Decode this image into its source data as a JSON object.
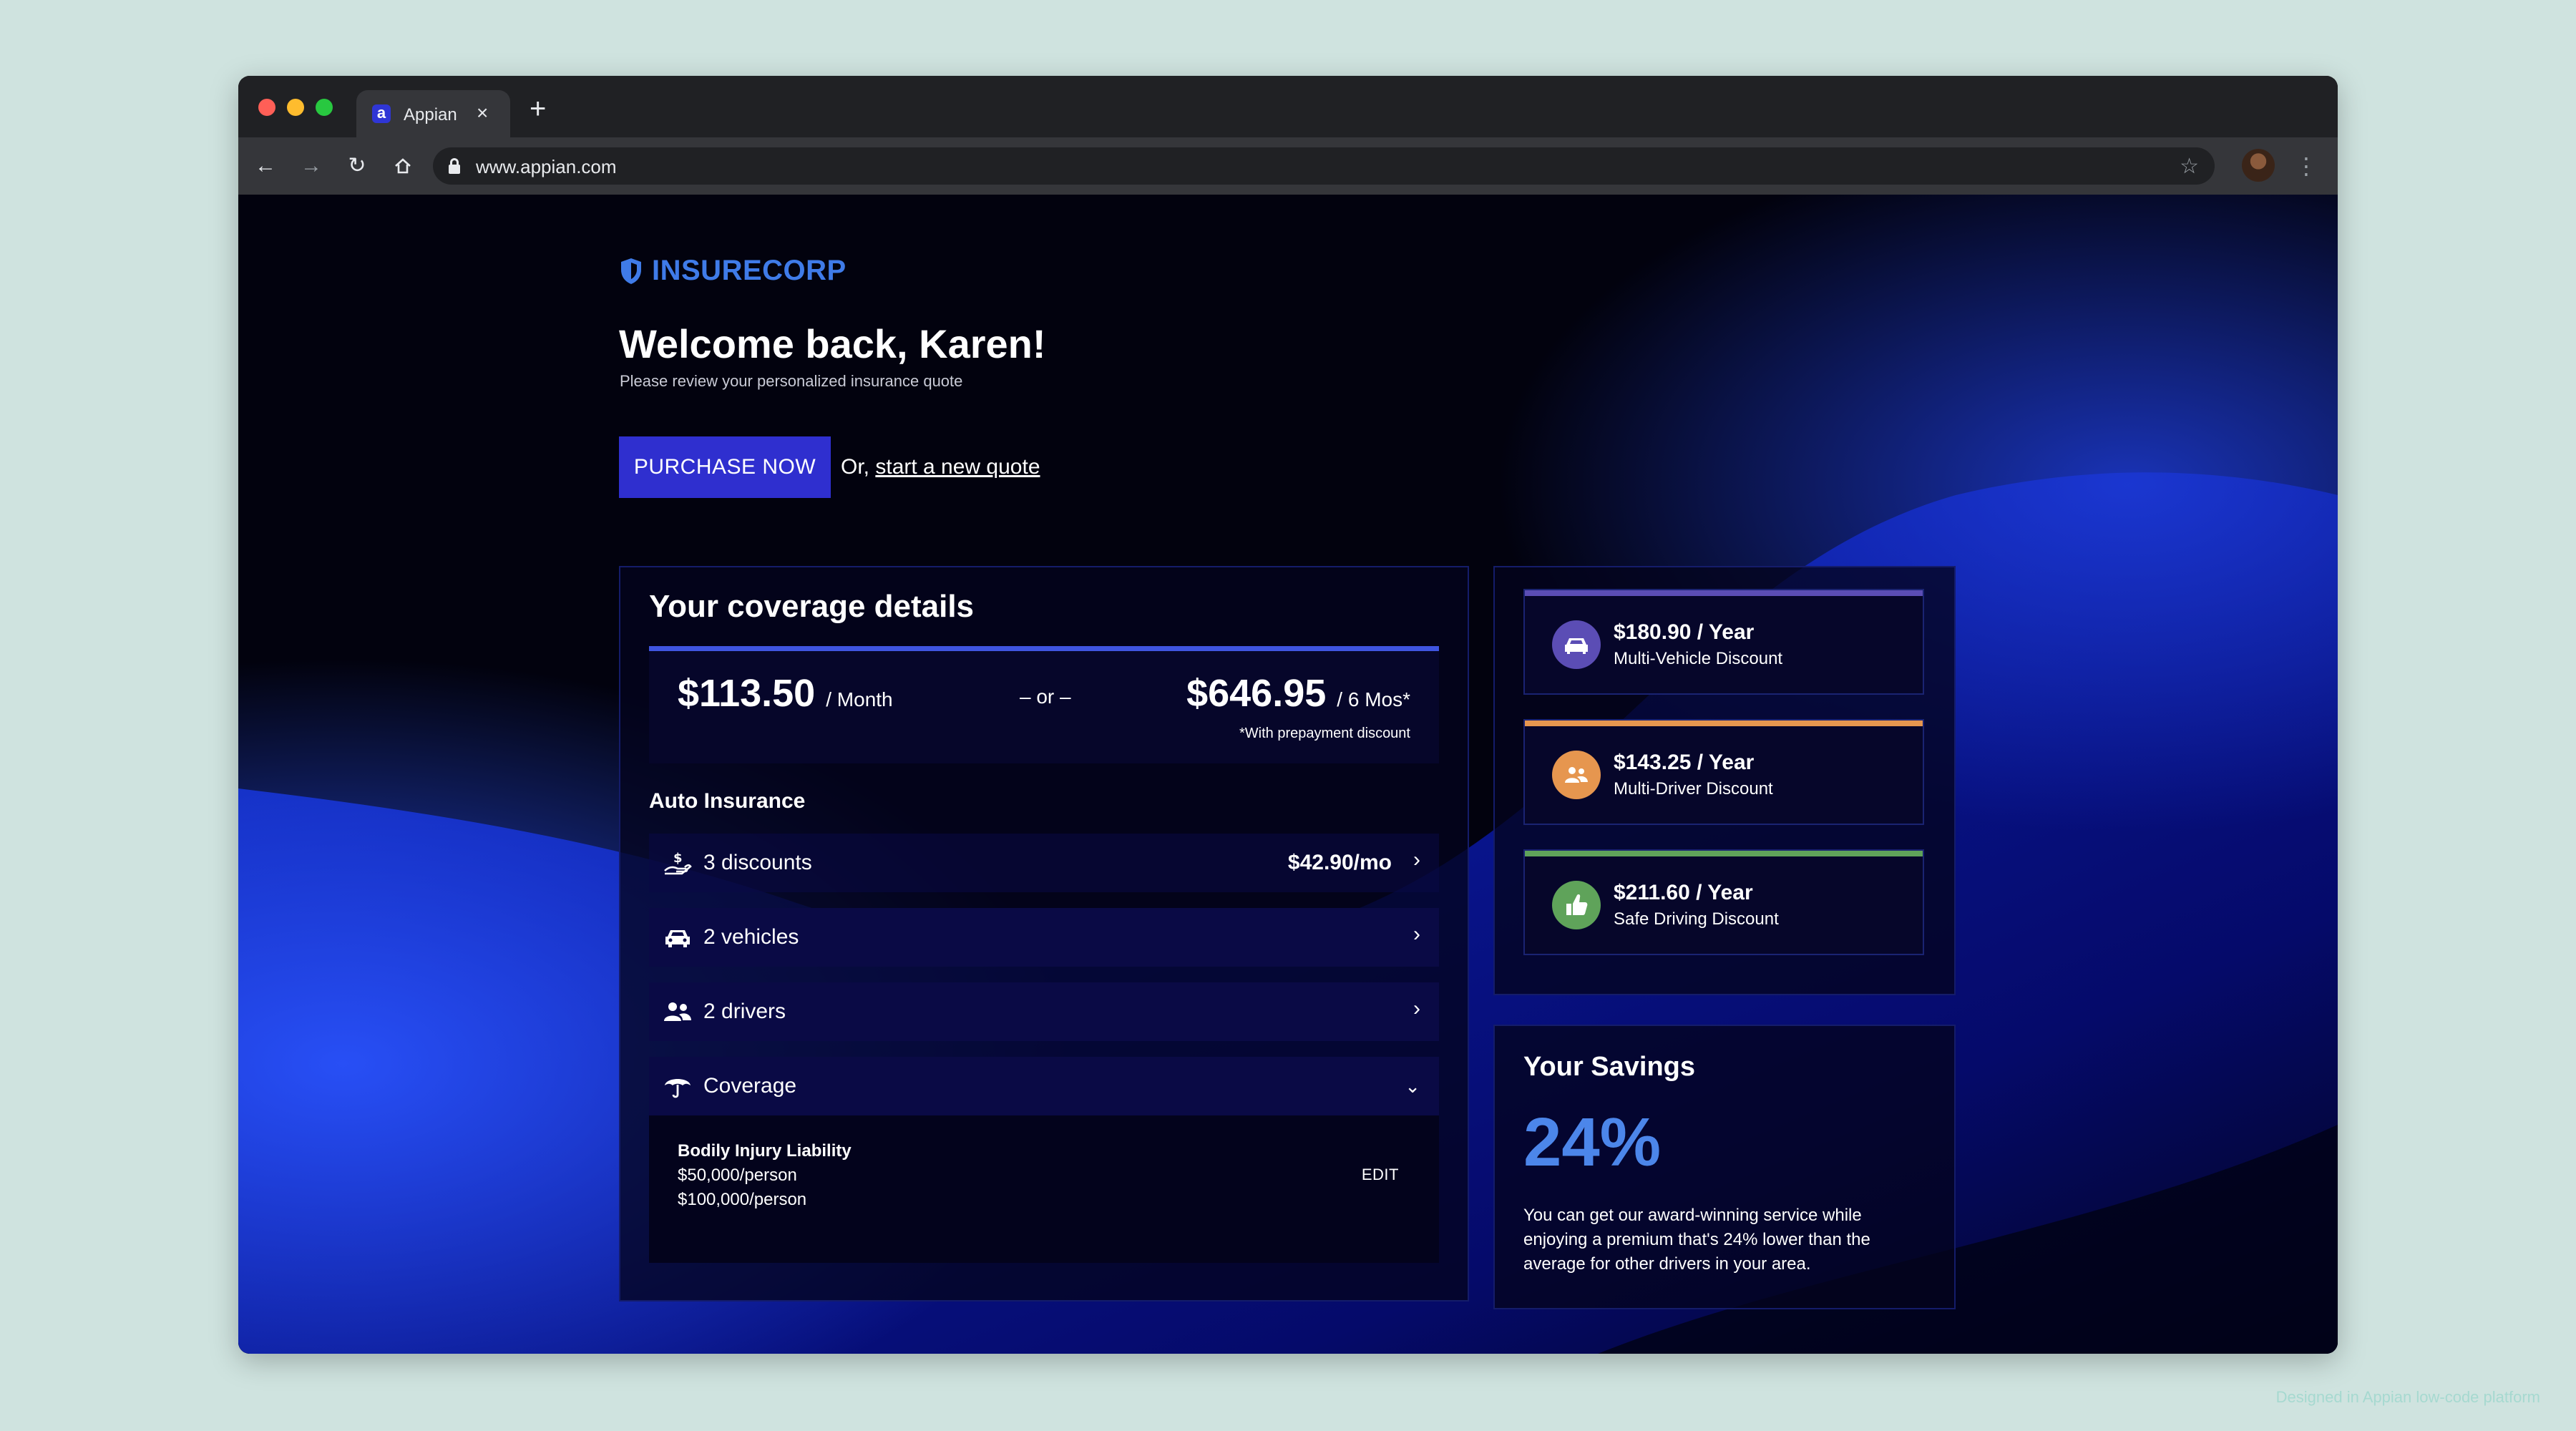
{
  "browser": {
    "tab_title": "Appian",
    "tab_favicon": "a",
    "url": "www.appian.com",
    "icons": [
      "back-arrow-icon",
      "forward-arrow-icon",
      "reload-icon",
      "home-icon",
      "lock-icon",
      "star-icon",
      "profile-avatar",
      "kebab-menu-icon",
      "close-icon",
      "plus-icon"
    ]
  },
  "page": {
    "brand": "INSURECORP",
    "brand_color": "#3f7be8",
    "welcome": "Welcome back, Karen!",
    "subtitle": "Please review your personalized insurance quote",
    "purchase_label": "PURCHASE NOW",
    "or_prefix": "Or,",
    "new_quote_link": "start a new quote",
    "accent_color": "#2f2fcf"
  },
  "coverage": {
    "title": "Your coverage details",
    "monthly_price": "$113.50",
    "monthly_unit": "/ Month",
    "or_text": "– or –",
    "six_month_price": "$646.95",
    "six_month_unit": "/ 6 Mos*",
    "prepay_note": "*With prepayment discount",
    "section_label": "Auto Insurance",
    "rows": [
      {
        "icon": "hand-dollar-icon",
        "label": "3 discounts",
        "value": "$42.90/mo"
      },
      {
        "icon": "car-icon",
        "label": "2 vehicles",
        "value": ""
      },
      {
        "icon": "people-icon",
        "label": "2 drivers",
        "value": ""
      },
      {
        "icon": "umbrella-icon",
        "label": "Coverage",
        "value": ""
      }
    ],
    "detail": {
      "title": "Bodily Injury Liability",
      "line1": "$50,000/person",
      "line2": "$100,000/person",
      "edit_label": "EDIT"
    }
  },
  "discounts": [
    {
      "amount": "$180.90 / Year",
      "label": "Multi-Vehicle Discount",
      "color": "#5b4db5",
      "icon": "car-icon"
    },
    {
      "amount": "$143.25 / Year",
      "label": "Multi-Driver Discount",
      "color": "#e6964f",
      "icon": "people-icon"
    },
    {
      "amount": "$211.60 / Year",
      "label": "Safe Driving Discount",
      "color": "#5fa35a",
      "icon": "thumbs-up-icon"
    }
  ],
  "savings": {
    "title": "Your Savings",
    "percent": "24%",
    "text": "You can get our award-winning service while enjoying a premium that's 24% lower than the average for other drivers in your area."
  },
  "footer_note": "Designed in Appian low-code platform"
}
